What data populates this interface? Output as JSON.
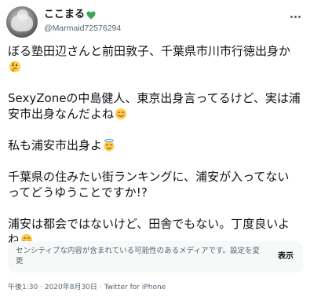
{
  "user": {
    "display_name": "ここまる",
    "handle": "@Marmaid72576294",
    "badge_icon": "green-heart-icon"
  },
  "menu": {
    "icon": "more-dots-icon"
  },
  "tweet": {
    "lines": [
      "ぼる塾田辺さんと前田敦子、千葉県市川市行徳出身か",
      "SexyZoneの中島健人、東京出身言ってるけど、実は浦",
      "安市出身なんだよね",
      "私も浦安市出身よ",
      "千葉県の住みたい街ランキングに、浦安が入ってない",
      "ってどうゆうことですか!?",
      "浦安は都会ではないけど、田舎でもない。丁度良いよ",
      "ね"
    ],
    "emojis": {
      "thinking": "thinking-face-icon",
      "smile": "smiling-face-icon",
      "halo": "smiling-face-with-halo-icon"
    }
  },
  "sensitive_notice": {
    "text": "センシティブな内容が含まれている可能性のあるメディアです。",
    "settings_link": "設定を変更",
    "show_label": "表示"
  },
  "meta": {
    "time": "午後1:30",
    "separator": "·",
    "date": "2020年8月30日",
    "source": "Twitter for iPhone"
  },
  "colors": {
    "text": "#0f1419",
    "secondary": "#536471",
    "media_bg": "#f7f9f9",
    "heart": "#3aa757",
    "emoji": "#ffcc4d"
  }
}
